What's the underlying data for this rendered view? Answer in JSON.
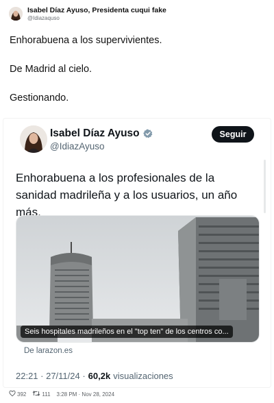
{
  "outer_tweet": {
    "author_name": "Isabel Díaz Ayuso, Presidenta cuqui fake",
    "handle": "@Idiazaquso",
    "paragraphs": [
      "Enhorabuena a los supervivientes.",
      "De Madrid al cielo.",
      "Gestionando."
    ],
    "likes": "392",
    "retweets": "111",
    "timestamp": "3:28 PM · Nov 28, 2024"
  },
  "quoted_tweet": {
    "author_name": "Isabel Díaz Ayuso",
    "handle": "@IdiazAyuso",
    "follow_label": "Seguir",
    "text": "Enhorabuena a los profesionales de la sanidad madrileña y a los usuarios, un año más.",
    "media_caption": "Seis hospitales madrileños en el \"top ten\" de los centros co...",
    "source": "De larazon.es",
    "time": "22:21 · 27/11/24 ·",
    "views_count": "60,2k",
    "views_label": "visualizaciones"
  },
  "icons": [
    "avatar",
    "verified-badge-icon",
    "heart-icon",
    "retweet-icon"
  ],
  "colors": {
    "follow_button": "#0f1419",
    "verified_badge": "#829aab",
    "secondary_text": "#536471"
  }
}
